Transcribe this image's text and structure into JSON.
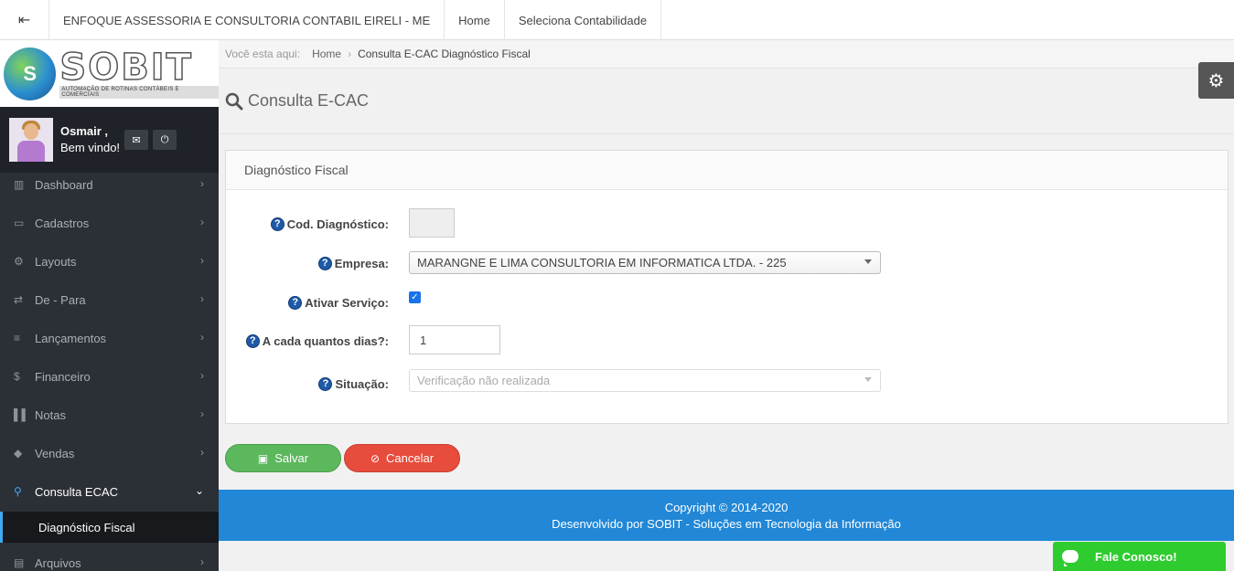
{
  "topbar": {
    "toggle_icon": "menu-toggle-icon",
    "company": "ENFOQUE ASSESSORIA E CONSULTORIA CONTABIL EIRELI - ME",
    "home": "Home",
    "select_accounting": "Seleciona Contabilidade"
  },
  "sidebar": {
    "logo_text": "SOBIT",
    "logo_tagline": "AUTOMAÇÃO DE ROTINAS CONTÁBEIS E COMERCIAIS",
    "user_name": "Osmair ,",
    "welcome": "Bem vindo!",
    "menu": [
      {
        "label": "Dashboard",
        "icon": "bar-chart-icon"
      },
      {
        "label": "Cadastros",
        "icon": "keyboard-icon"
      },
      {
        "label": "Layouts",
        "icon": "gears-icon"
      },
      {
        "label": "De - Para",
        "icon": "exchange-icon"
      },
      {
        "label": "Lançamentos",
        "icon": "list-icon"
      },
      {
        "label": "Financeiro",
        "icon": "dollar-icon"
      },
      {
        "label": "Notas",
        "icon": "barcode-icon"
      },
      {
        "label": "Vendas",
        "icon": "tags-icon"
      },
      {
        "label": "Consulta ECAC",
        "icon": "search-icon"
      },
      {
        "label": "Arquivos",
        "icon": "archive-icon"
      }
    ],
    "submenu_active": "Diagnóstico Fiscal"
  },
  "breadcrumb": {
    "prefix": "Você esta aqui:",
    "home": "Home",
    "current": "Consulta E-CAC Diagnóstico Fiscal"
  },
  "page": {
    "title": "Consulta E-CAC"
  },
  "form": {
    "panel_title": "Diagnóstico Fiscal",
    "cod_label": "Cod. Diagnóstico:",
    "cod_value": "",
    "empresa_label": "Empresa:",
    "empresa_value": "MARANGNE E LIMA CONSULTORIA EM INFORMATICA LTDA. - 225",
    "ativar_label": "Ativar Serviço:",
    "ativar_checked": true,
    "dias_label": "A cada quantos dias?:",
    "dias_value": "1",
    "situacao_label": "Situação:",
    "situacao_value": "Verificação não realizada"
  },
  "buttons": {
    "save": "Salvar",
    "cancel": "Cancelar"
  },
  "footer": {
    "copyright": "Copyright © 2014-2020",
    "developer": "Desenvolvido por SOBIT - Soluções em Tecnologia da Informação"
  },
  "chat": {
    "label": "Fale Conosco!"
  },
  "colors": {
    "sidebar_bg": "#2b2f36",
    "accent_blue": "#2187d6",
    "save_green": "#5cb85c",
    "cancel_red": "#e74c3c",
    "chat_green": "#2ecc2e"
  }
}
